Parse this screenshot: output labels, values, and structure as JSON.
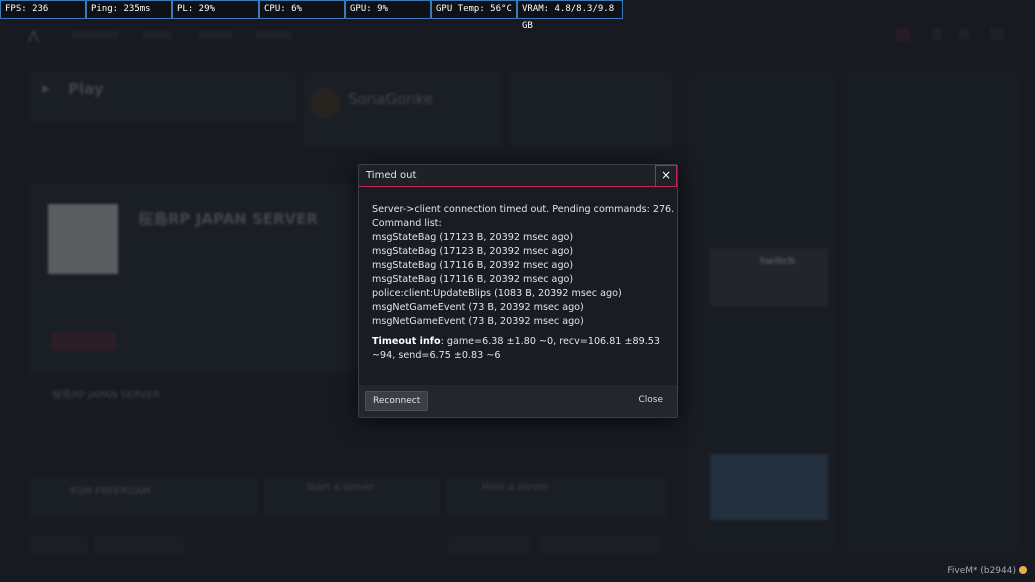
{
  "perf": [
    {
      "label": "FPS: 236"
    },
    {
      "label": "Ping: 235ms"
    },
    {
      "label": "PL: 29%"
    },
    {
      "label": "CPU: 6%"
    },
    {
      "label": "GPU: 9%"
    },
    {
      "label": "GPU Temp: 56°C"
    },
    {
      "label": "VRAM: 4.8/8.3/9.8 GB"
    }
  ],
  "background": {
    "play_label": "Play",
    "server_title": "桜島RP JAPAN SERVER",
    "server_subtitle": "桜島RP JAPAN SERVER",
    "featured_name": "SonaGonke",
    "freeroam": "RSM FREEROAM",
    "start_server": "Start a server",
    "host_server": "Host a server",
    "twitch": "twitch"
  },
  "dialog": {
    "title": "Timed out",
    "close_x": "×",
    "lines": [
      "Server->client connection timed out. Pending commands: 276.",
      "Command list:",
      "msgStateBag (17123 B, 20392 msec ago)",
      "msgStateBag (17123 B, 20392 msec ago)",
      "msgStateBag (17116 B, 20392 msec ago)",
      "msgStateBag (17116 B, 20392 msec ago)",
      "police:client:UpdateBlips (1083 B, 20392 msec ago)",
      "msgNetGameEvent (73 B, 20392 msec ago)",
      "msgNetGameEvent (73 B, 20392 msec ago)"
    ],
    "timeout_label": "Timeout info",
    "timeout_text": ": game=6.38 ±1.80 ~0, recv=106.81 ±89.53 ~94, send=6.75 ±0.83 ~6",
    "reconnect_label": "Reconnect",
    "close_label": "Close"
  },
  "footer": {
    "version": "FiveM* (b2944)"
  },
  "colors": {
    "accent": "#c1254f",
    "perf_border": "#3a7bbf",
    "background": "#1b1e25"
  }
}
